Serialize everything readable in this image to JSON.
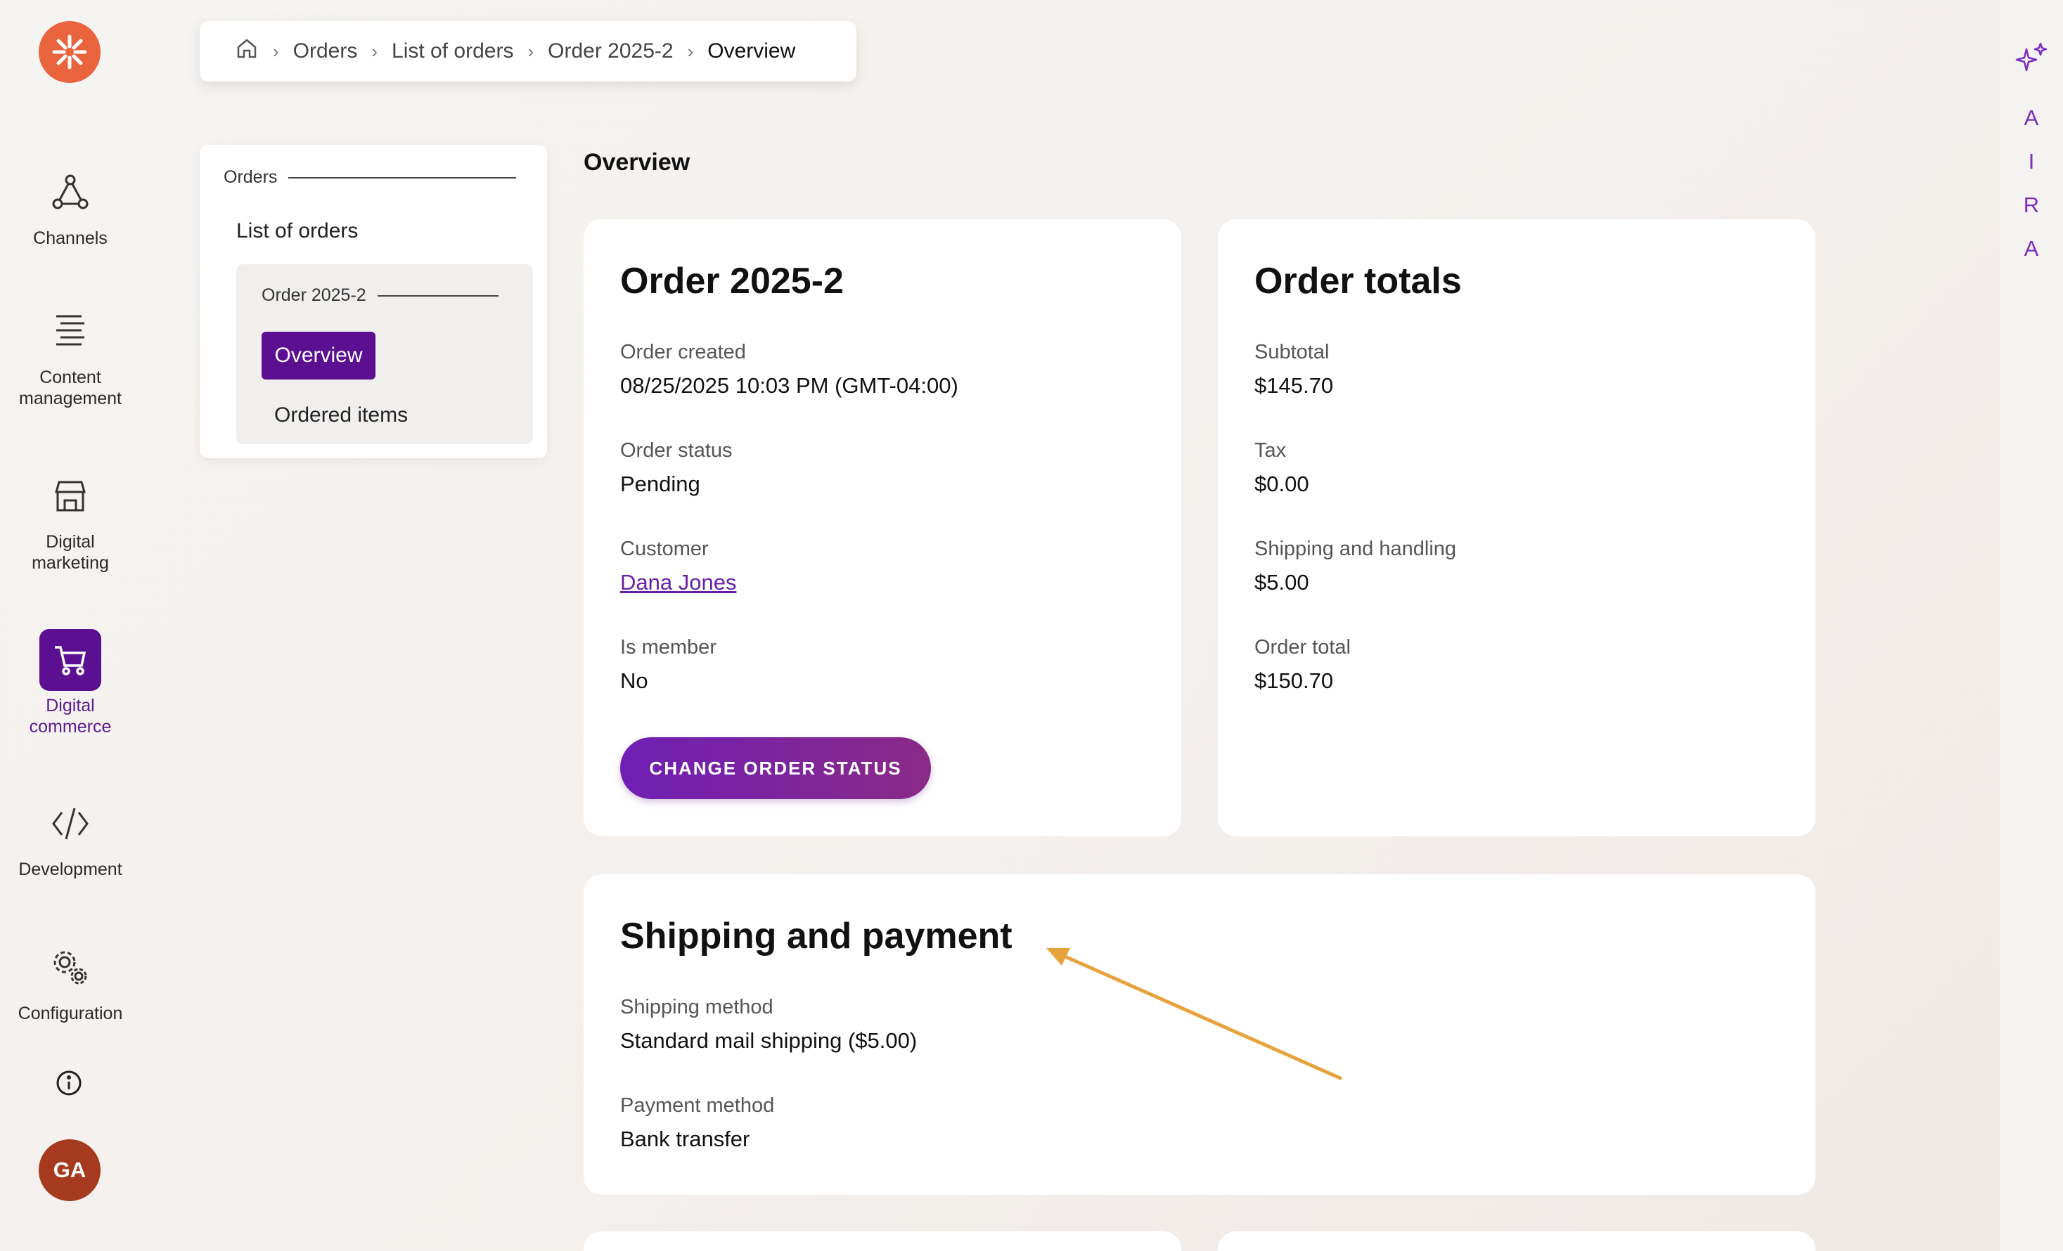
{
  "nav": {
    "items": [
      {
        "label": "Channels",
        "icon": "channels-icon"
      },
      {
        "label": "Content\nmanagement",
        "icon": "content-management-icon"
      },
      {
        "label": "Digital\nmarketing",
        "icon": "digital-marketing-icon"
      },
      {
        "label": "Digital\ncommerce",
        "icon": "cart-icon",
        "active": true
      },
      {
        "label": "Development",
        "icon": "code-icon"
      },
      {
        "label": "Configuration",
        "icon": "gears-icon"
      }
    ],
    "avatar_initials": "GA"
  },
  "breadcrumb": {
    "items": [
      "Orders",
      "List of orders",
      "Order 2025-2",
      "Overview"
    ]
  },
  "subnav": {
    "section_title": "Orders",
    "list_link": "List of orders",
    "group_title": "Order 2025-2",
    "active_item": "Overview",
    "other_item": "Ordered items"
  },
  "page": {
    "title": "Overview"
  },
  "order_card": {
    "title": "Order 2025-2",
    "fields": [
      {
        "label": "Order created",
        "value": "08/25/2025 10:03 PM (GMT-04:00)"
      },
      {
        "label": "Order status",
        "value": "Pending"
      },
      {
        "label": "Customer",
        "value": "Dana Jones"
      },
      {
        "label": "Is member",
        "value": "No"
      }
    ],
    "button_label": "CHANGE ORDER STATUS"
  },
  "totals_card": {
    "title": "Order totals",
    "fields": [
      {
        "label": "Subtotal",
        "value": "$145.70"
      },
      {
        "label": "Tax",
        "value": "$0.00"
      },
      {
        "label": "Shipping and handling",
        "value": "$5.00"
      },
      {
        "label": "Order total",
        "value": "$150.70"
      }
    ]
  },
  "shipping_card": {
    "title": "Shipping and payment",
    "fields": [
      {
        "label": "Shipping method",
        "value": "Standard mail shipping ($5.00)"
      },
      {
        "label": "Payment method",
        "value": "Bank transfer"
      }
    ]
  },
  "right_rail": {
    "letters": [
      "A",
      "I",
      "R",
      "A"
    ]
  },
  "colors": {
    "brand_purple": "#5b1091",
    "accent_orange": "#e9643d",
    "annotation_arrow": "#e8a23d"
  }
}
